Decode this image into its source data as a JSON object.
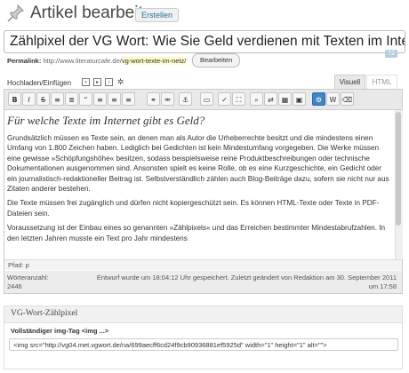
{
  "header": {
    "title": "Artikel bearbeiten",
    "create_button": "Erstellen"
  },
  "post": {
    "title": "Zählpixel der VG Wort: Wie Sie Geld verdienen mit Texten im Internet",
    "badge": "T2",
    "permalink_label": "Permalink:",
    "permalink_base": "http://www.literaturcafe.de/",
    "permalink_slug": "vg-wort-texte-im-netz/",
    "edit_button": "Bearbeiten"
  },
  "upload": {
    "label": "Hochladen/Einfügen"
  },
  "tabs": {
    "visual": "Visuell",
    "html": "HTML"
  },
  "toolbar": [
    {
      "name": "bold",
      "glyph": "B"
    },
    {
      "name": "italic",
      "glyph": "I"
    },
    {
      "name": "strikethrough",
      "glyph": "S"
    },
    {
      "name": "bullet-list",
      "glyph": "≡"
    },
    {
      "name": "numbered-list",
      "glyph": "≣"
    },
    {
      "name": "blockquote",
      "glyph": "“"
    },
    {
      "name": "align-left",
      "glyph": "≡"
    },
    {
      "name": "align-center",
      "glyph": "≡"
    },
    {
      "name": "align-right",
      "glyph": "≡"
    },
    {
      "name": "link",
      "glyph": "⚭"
    },
    {
      "name": "unlink",
      "glyph": "⚮"
    },
    {
      "name": "anchor",
      "glyph": "⚓"
    },
    {
      "name": "more",
      "glyph": "▭"
    },
    {
      "name": "spellcheck",
      "glyph": "✓"
    },
    {
      "name": "fullscreen",
      "glyph": "⛶"
    },
    {
      "name": "find",
      "glyph": "⌕"
    },
    {
      "name": "replace",
      "glyph": "⇄"
    },
    {
      "name": "table",
      "glyph": "▦"
    },
    {
      "name": "media",
      "glyph": "▣"
    },
    {
      "name": "kitchen-sink",
      "glyph": "⚙"
    },
    {
      "name": "paste-word",
      "glyph": "W"
    },
    {
      "name": "clear-format",
      "glyph": "⌫"
    }
  ],
  "content": {
    "heading": "Für welche Texte im Internet gibt es Geld?",
    "paragraphs": [
      "Grundsätzlich müssen es Texte sein, an denen man als Autor die Urheberrechte besitzt und die mindestens einen Umfang von 1.800 Zeichen haben. Lediglich bei Gedichten ist kein Mindestumfang vorgegeben. Die Werke müssen eine gewisse »Schöpfungshöhe« besitzen, sodass beispielsweise reine Produktbeschreibungen oder technische Dokumentationen ausgenommen sind. Ansonsten spielt es keine Rolle, ob es eine Kurzgeschichte, ein Gedicht oder ein journalistisch-redaktioneller Beitrag ist. Selbstverständlich zählen auch Blog-Beiträge dazu, sofern sie nicht nur aus Zitaten anderer bestehen.",
      "Die Texte müssen frei zugänglich und dürfen nicht kopiergeschützt sein. Es können HTML-Texte oder Texte in PDF-Dateien sein.",
      "Voraussetzung ist der Einbau eines so genannten »Zählpixels« und das Erreichen bestimmter Mindestabrufzahlen. In den letzten Jahren musste ein Text pro Jahr mindestens"
    ]
  },
  "path": "Pfad: p",
  "status": {
    "word_count_label": "Wörteranzahl:",
    "word_count": "2446",
    "draft_line1": "Entwurf wurde um 18:04:12 Uhr gespeichert. Zuletzt geändert von Redaktion am 30. September 2011",
    "draft_line2": "um 17:58"
  },
  "metabox": {
    "title": "VG-Wort-Zählpixel",
    "field_label": "Vollständiger img-Tag <img ...>",
    "field_value": "<img src=\"http://vg04.met.vgwort.de/na/699aecff6cd24f9cb90936881ef5925d\" width=\"1\" height=\"1\" alt=\"\">"
  },
  "colors": {
    "accent": "#21759b",
    "toolbar_active": "#3e84c6",
    "slug_highlight": "#fffbcc"
  }
}
